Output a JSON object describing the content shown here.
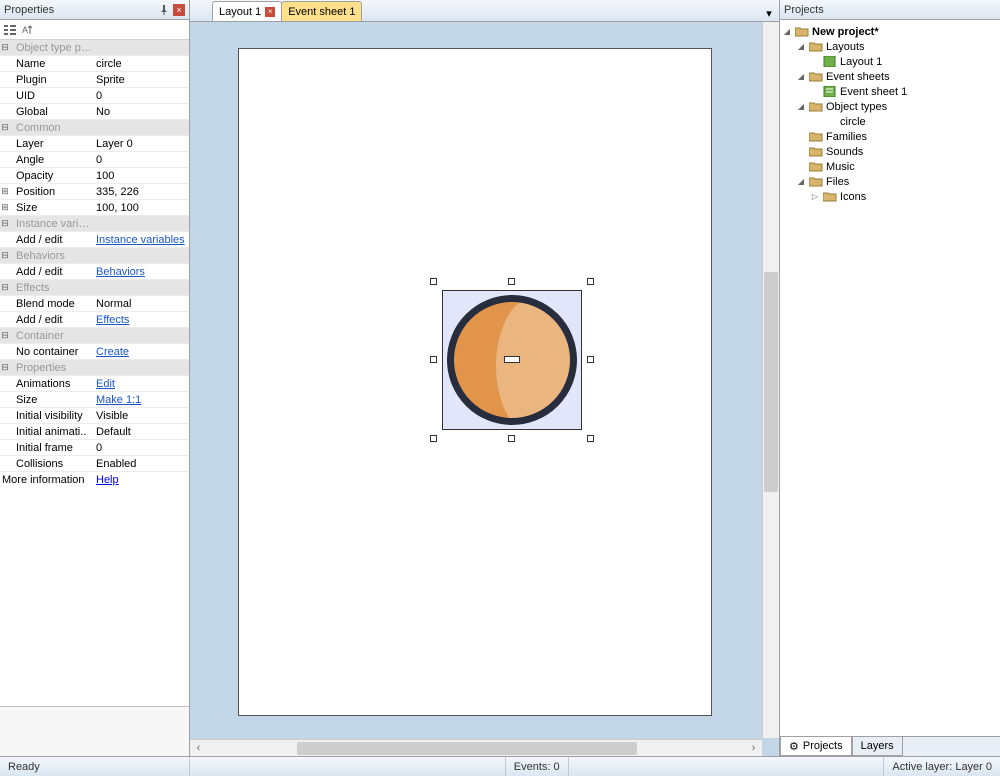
{
  "panels": {
    "properties_title": "Properties",
    "projects_title": "Projects"
  },
  "tabs": {
    "layout": "Layout 1",
    "eventsheet": "Event sheet 1"
  },
  "groups": {
    "object_type": "Object type properties",
    "common": "Common",
    "instance_vars": "Instance variables",
    "behaviors": "Behaviors",
    "effects": "Effects",
    "container": "Container",
    "properties": "Properties"
  },
  "props": {
    "name_k": "Name",
    "name_v": "circle",
    "plugin_k": "Plugin",
    "plugin_v": "Sprite",
    "uid_k": "UID",
    "uid_v": "0",
    "global_k": "Global",
    "global_v": "No",
    "layer_k": "Layer",
    "layer_v": "Layer 0",
    "angle_k": "Angle",
    "angle_v": "0",
    "opacity_k": "Opacity",
    "opacity_v": "100",
    "position_k": "Position",
    "position_v": "335, 226",
    "size_k": "Size",
    "size_v": "100, 100",
    "iv_addedit_k": "Add / edit",
    "iv_addedit_v": "Instance variables",
    "bh_addedit_k": "Add / edit",
    "bh_addedit_v": "Behaviors",
    "blend_k": "Blend mode",
    "blend_v": "Normal",
    "fx_addedit_k": "Add / edit",
    "fx_addedit_v": "Effects",
    "nocontainer_k": "No container",
    "nocontainer_v": "Create",
    "anim_k": "Animations",
    "anim_v": "Edit",
    "psize_k": "Size",
    "psize_v": "Make 1:1",
    "vis_k": "Initial visibility",
    "vis_v": "Visible",
    "ianim_k": "Initial animati..",
    "ianim_v": "Default",
    "iframe_k": "Initial frame",
    "iframe_v": "0",
    "coll_k": "Collisions",
    "coll_v": "Enabled",
    "more_k": "More information",
    "more_v": "Help"
  },
  "tree": {
    "project": "New project*",
    "layouts": "Layouts",
    "layout1": "Layout 1",
    "eventsheets": "Event sheets",
    "eventsheet1": "Event sheet 1",
    "objtypes": "Object types",
    "circle": "circle",
    "families": "Families",
    "sounds": "Sounds",
    "music": "Music",
    "files": "Files",
    "icons": "Icons"
  },
  "rtabs": {
    "projects": "Projects",
    "layers": "Layers"
  },
  "status": {
    "ready": "Ready",
    "events": "Events: 0",
    "activelayer": "Active layer: Layer 0"
  }
}
